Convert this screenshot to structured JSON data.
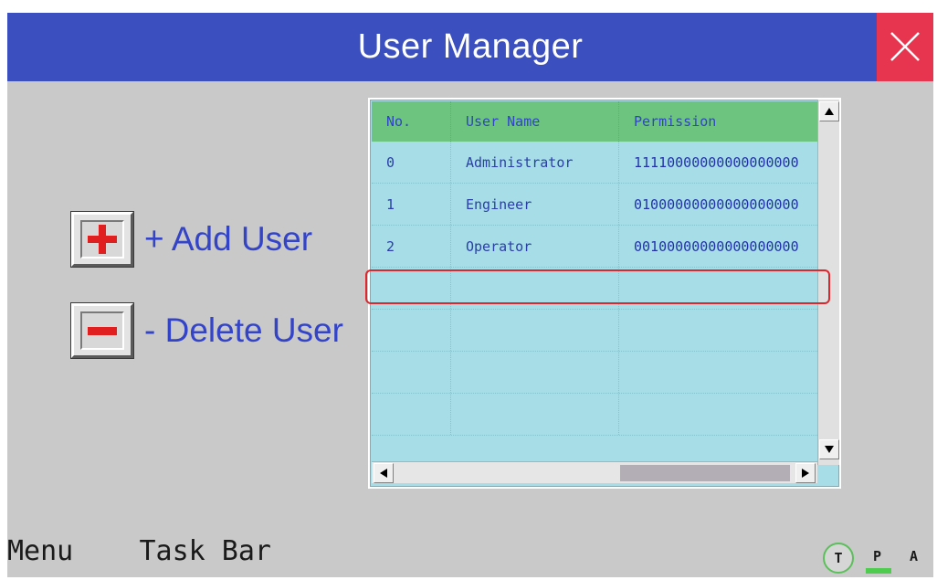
{
  "window": {
    "title": "User Manager",
    "close_icon": "close-icon"
  },
  "actions": {
    "add_label": "+ Add User",
    "add_icon": "plus-icon",
    "delete_label": "- Delete User",
    "delete_icon": "minus-icon"
  },
  "table": {
    "columns": [
      "No.",
      "User Name",
      "Permission"
    ],
    "rows": [
      [
        "0",
        "Administrator",
        "11110000000000000000"
      ],
      [
        "1",
        "Engineer",
        "01000000000000000000"
      ],
      [
        "2",
        "Operator",
        "00100000000000000000"
      ]
    ],
    "empty_row_count": 4
  },
  "taskbar": {
    "menu_label": "Menu",
    "taskbar_label": "Task Bar",
    "mode_t": "T",
    "mode_p": "P",
    "mode_a": "A"
  },
  "colors": {
    "title_bar": "#3b4fbf",
    "close_button": "#e8354f",
    "table_bg": "#a6dde7",
    "header_bg": "#6dc47e",
    "text_blue": "#3344c8",
    "highlight": "#e0262d",
    "active_mode": "#4fcb4f"
  }
}
